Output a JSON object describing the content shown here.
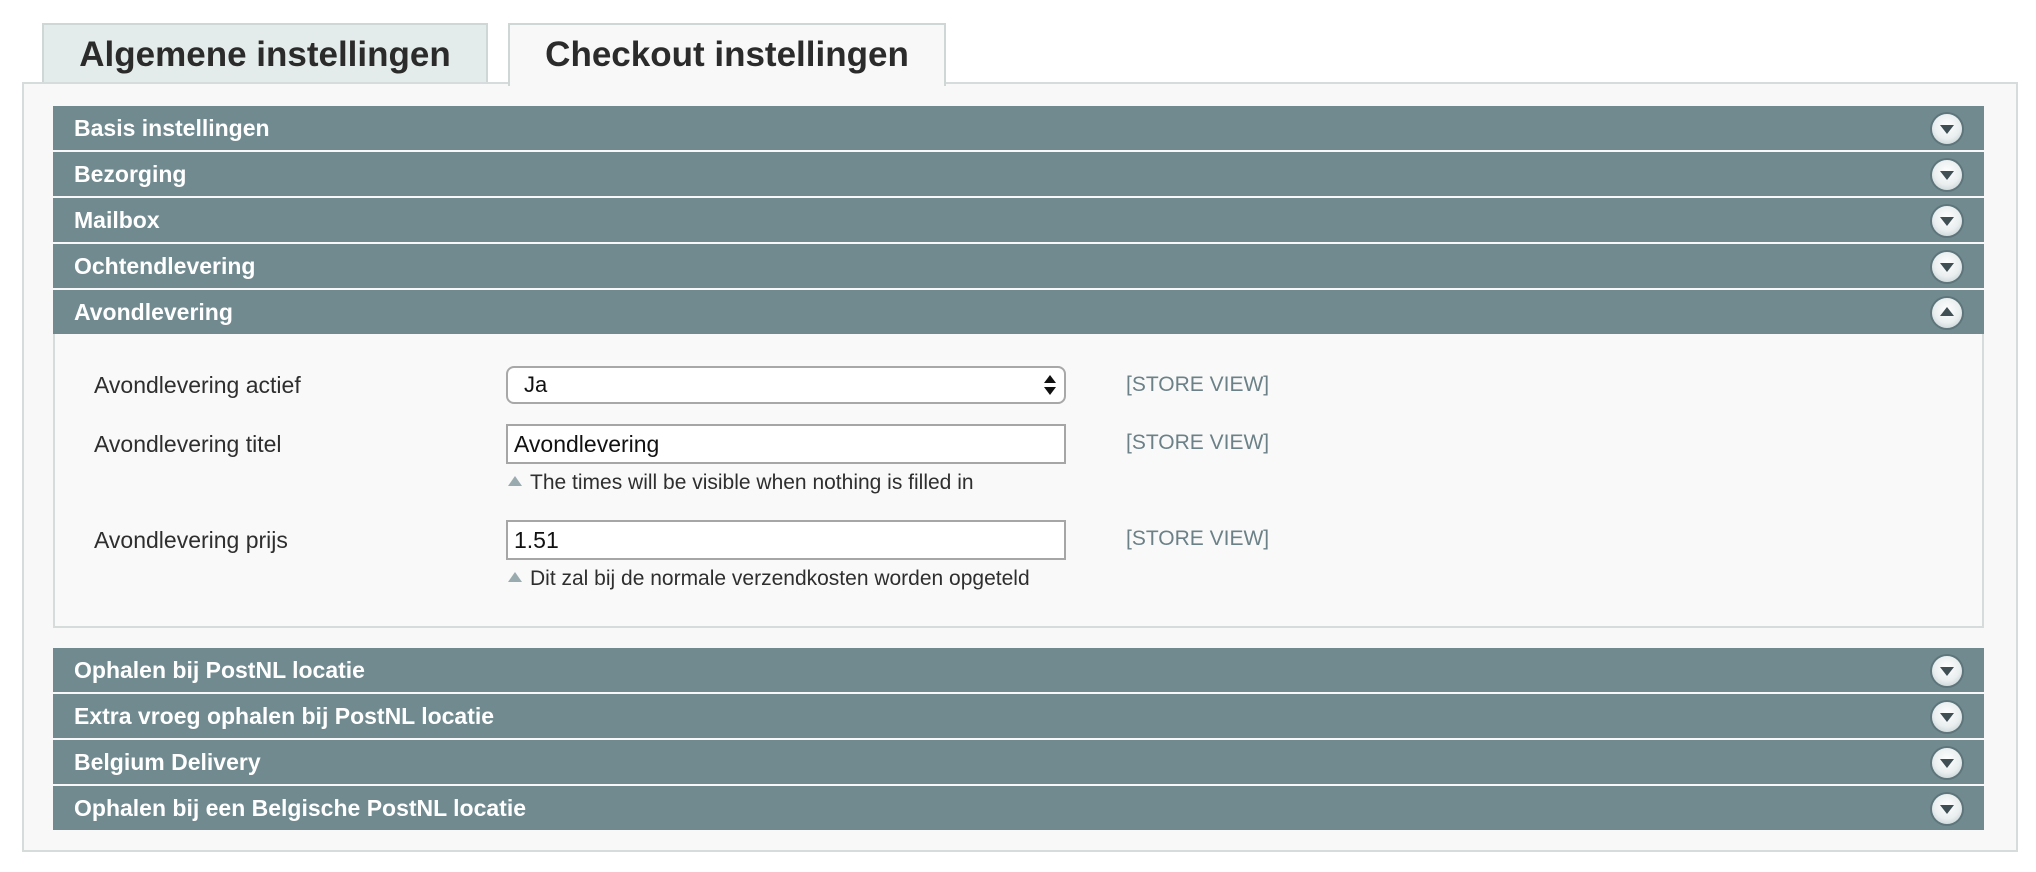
{
  "tabs": [
    {
      "label": "Algemene instellingen",
      "active": false
    },
    {
      "label": "Checkout instellingen",
      "active": true
    }
  ],
  "sections": [
    {
      "label": "Basis instellingen",
      "expanded": false
    },
    {
      "label": "Bezorging",
      "expanded": false
    },
    {
      "label": "Mailbox",
      "expanded": false
    },
    {
      "label": "Ochtendlevering",
      "expanded": false
    },
    {
      "label": "Avondlevering",
      "expanded": true
    },
    {
      "label": "Ophalen bij PostNL locatie",
      "expanded": false
    },
    {
      "label": "Extra vroeg ophalen bij PostNL locatie",
      "expanded": false
    },
    {
      "label": "Belgium Delivery",
      "expanded": false
    },
    {
      "label": "Ophalen bij een Belgische PostNL locatie",
      "expanded": false
    }
  ],
  "avondlevering": {
    "actief": {
      "label": "Avondlevering actief",
      "value": "Ja",
      "scope": "[STORE VIEW]"
    },
    "titel": {
      "label": "Avondlevering titel",
      "value": "Avondlevering",
      "scope": "[STORE VIEW]",
      "note": "The times will be visible when nothing is filled in"
    },
    "prijs": {
      "label": "Avondlevering prijs",
      "value": "1.51",
      "scope": "[STORE VIEW]",
      "note": "Dit zal bij de normale verzendkosten worden opgeteld"
    }
  },
  "colors": {
    "section_header": "#708a90",
    "tab_inactive": "#e3ecea",
    "panel_background": "#f8f8f8",
    "scope_text": "#6b8187"
  },
  "icons": {
    "collapsed": "chevron-down-icon",
    "expanded": "chevron-up-icon",
    "select": "select-arrows-icon",
    "note": "triangle-up-icon"
  }
}
